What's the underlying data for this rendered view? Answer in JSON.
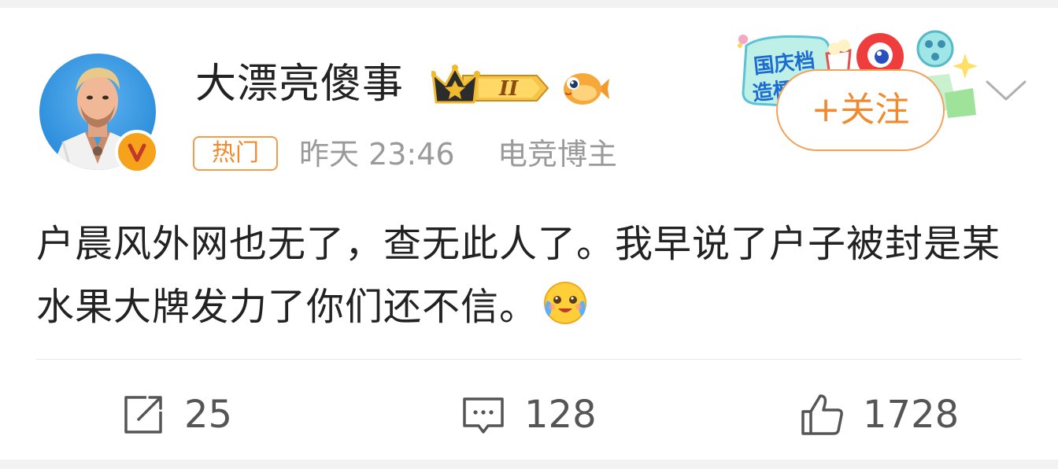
{
  "user": {
    "name": "大漂亮傻事",
    "level_badge": "II",
    "verified_mark": "V"
  },
  "meta": {
    "hot_tag": "热门",
    "time": "昨天 23:46",
    "role": "电竞博主"
  },
  "banner": {
    "text_line1": "国庆档",
    "text_line2": "造梗"
  },
  "follow_button": {
    "label": "+关注"
  },
  "post": {
    "text": "户晨风外网也无了，查无此人了。我早说了户子被封是某水果大牌发力了你们还不信。",
    "emoji": "crying-laughing-emoji"
  },
  "actions": {
    "repost_count": "25",
    "comment_count": "128",
    "like_count": "1728"
  },
  "colors": {
    "accent_orange": "#f08a2c",
    "text_main": "#222222",
    "text_meta": "#9a9a9a",
    "verified": "#f7a21b"
  }
}
